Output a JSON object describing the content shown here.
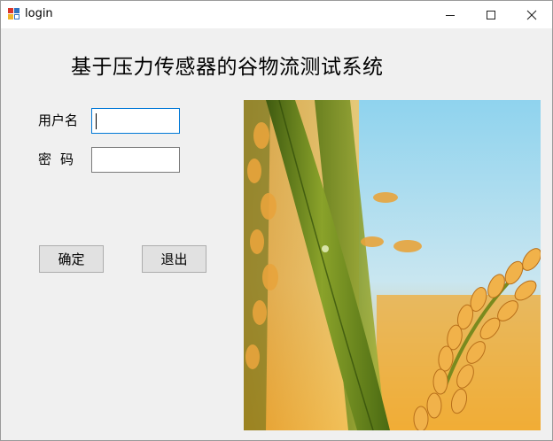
{
  "window": {
    "title": "login",
    "icon": "windows-forms-app-icon",
    "controls": {
      "minimize": "minimize-icon",
      "maximize": "maximize-icon",
      "close": "close-icon"
    }
  },
  "form": {
    "heading": "基于压力传感器的谷物流测试系统",
    "username_label": "用户名",
    "password_label": "密码",
    "username_value": "",
    "password_value": "",
    "ok_button": "确定",
    "exit_button": "退出"
  },
  "image": {
    "subject": "rice-grain-photo"
  },
  "colors": {
    "window_bg": "#f0f0f0",
    "titlebar_bg": "#ffffff",
    "focus_border": "#0078d7",
    "button_bg": "#e1e1e1",
    "sky": "#8fd3ee",
    "grain": "#e0a23c"
  }
}
